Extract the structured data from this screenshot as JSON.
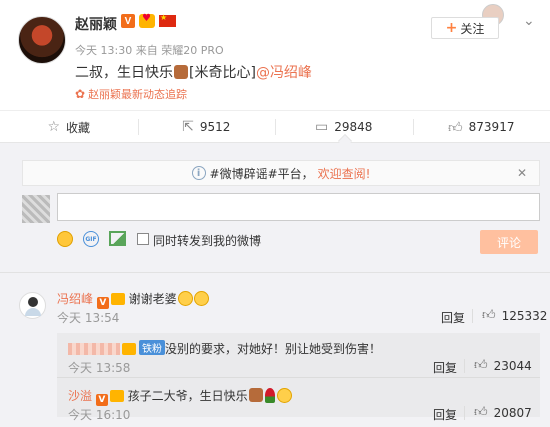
{
  "post": {
    "author": "赵丽颖",
    "v_badge": "V",
    "time": "今天 13:30",
    "source": "来自 荣耀20 PRO",
    "text_prefix": "二叔，生日快乐",
    "text_bracket": "[米奇比心]",
    "mention": "@冯绍峰",
    "follow_tag": "赵丽颖最新动态追踪",
    "follow_button": "关注",
    "close_icon": "chevron-down-icon"
  },
  "actions": {
    "collect": "收藏",
    "repost": "9512",
    "comments": "29848",
    "likes": "873917"
  },
  "comment_box": {
    "notice_prefix": "#微博辟谣#平台，",
    "notice_link": "欢迎查阅!",
    "repost_label": "同时转发到我的微博",
    "submit": "评论"
  },
  "comments": [
    {
      "user": "冯绍峰",
      "text": "谢谢老婆",
      "time": "今天 13:54",
      "reply": "回复",
      "likes": "125332"
    }
  ],
  "replies": [
    {
      "badge": "铁粉",
      "text": "没别的要求，对她好！别让她受到伤害！",
      "time": "今天 13:58",
      "reply": "回复",
      "likes": "23044"
    },
    {
      "user": "沙溢",
      "text": "孩子二大爷，生日快乐",
      "time": "今天 16:10",
      "reply": "回复",
      "likes": "20807"
    }
  ],
  "colors": {
    "accent": "#eb7350",
    "v_badge": "#f26d1a",
    "submit_disabled": "#ffc09f"
  }
}
